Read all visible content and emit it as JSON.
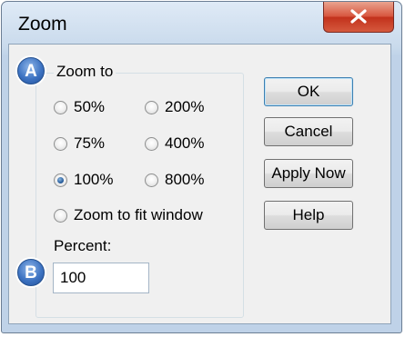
{
  "window": {
    "title": "Zoom"
  },
  "group": {
    "label": "Zoom to",
    "options": [
      {
        "label": "50%",
        "checked": false
      },
      {
        "label": "200%",
        "checked": false
      },
      {
        "label": "75%",
        "checked": false
      },
      {
        "label": "400%",
        "checked": false
      },
      {
        "label": "100%",
        "checked": true
      },
      {
        "label": "800%",
        "checked": false
      },
      {
        "label": "Zoom to fit window",
        "checked": false
      }
    ]
  },
  "percent": {
    "label": "Percent:",
    "value": "100"
  },
  "buttons": {
    "ok": "OK",
    "cancel": "Cancel",
    "apply": "Apply Now",
    "help": "Help"
  },
  "callouts": {
    "a": "A",
    "b": "B"
  },
  "colors": {
    "accent": "#3d73c2",
    "close": "#c2321c"
  }
}
